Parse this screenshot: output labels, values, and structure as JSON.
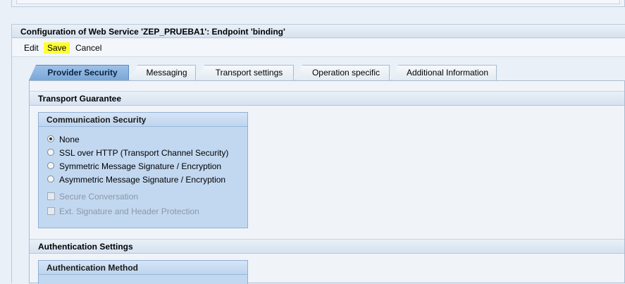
{
  "title": "Configuration of Web Service 'ZEP_PRUEBA1': Endpoint 'binding'",
  "toolbar": {
    "edit": "Edit",
    "save": "Save",
    "cancel": "Cancel"
  },
  "tabs": [
    {
      "label": "Provider Security",
      "active": true
    },
    {
      "label": "Messaging",
      "active": false
    },
    {
      "label": "Transport settings",
      "active": false
    },
    {
      "label": "Operation specific",
      "active": false
    },
    {
      "label": "Additional Information",
      "active": false
    }
  ],
  "transport_guarantee": {
    "header": "Transport Guarantee",
    "communication_security": {
      "header": "Communication Security",
      "options": [
        {
          "label": "None",
          "selected": true
        },
        {
          "label": "SSL over HTTP (Transport Channel Security)",
          "selected": false
        },
        {
          "label": "Symmetric Message Signature / Encryption",
          "selected": false
        },
        {
          "label": "Asymmetric Message Signature / Encryption",
          "selected": false
        }
      ],
      "checkboxes": [
        {
          "label": "Secure Conversation",
          "checked": false,
          "enabled": false
        },
        {
          "label": "Ext. Signature and Header Protection",
          "checked": false,
          "enabled": false
        }
      ]
    }
  },
  "authentication_settings": {
    "header": "Authentication Settings",
    "authentication_method": {
      "header": "Authentication Method"
    }
  },
  "colors": {
    "save_highlight": "#ffff33",
    "active_tab": "#8fb6e2",
    "group_bg": "#c2d8f1"
  }
}
